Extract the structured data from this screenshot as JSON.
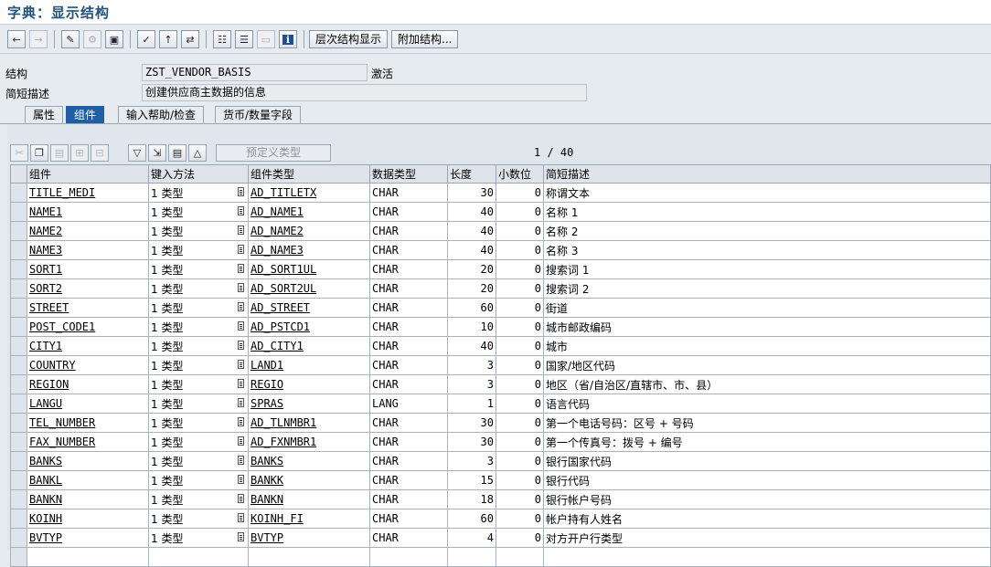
{
  "title": "字典：显示结构",
  "toolbar": {
    "icons": [
      "back-icon",
      "forward-icon",
      "display-change-icon",
      "active-inactive-icon",
      "other-object-icon",
      "check-icon",
      "activate-icon",
      "where-used-icon",
      "object-list-icon",
      "display-object-list-icon",
      "navigation-window-icon",
      "info-icon"
    ],
    "hier_label": "层次结构显示",
    "append_label": "附加结构..."
  },
  "header": {
    "structure_label": "结构",
    "structure_value": "ZST_VENDOR_BASIS",
    "status": "激活",
    "desc_label": "简短描述",
    "desc_value": "创建供应商主数据的信息"
  },
  "tabs": [
    {
      "label": "属性",
      "active": false
    },
    {
      "label": "组件",
      "active": true
    },
    {
      "label": "输入帮助/检查",
      "active": false
    },
    {
      "label": "货币/数量字段",
      "active": false
    }
  ],
  "grid_toolbar": {
    "predefined_label": "预定义类型",
    "pager": "1 / 40"
  },
  "table": {
    "columns": [
      "组件",
      "键入方法",
      "组件类型",
      "数据类型",
      "长度",
      "小数位",
      "简短描述"
    ],
    "rows": [
      {
        "comp": "TITLE_MEDI",
        "method": "1 类型",
        "ctype": "AD_TITLETX",
        "dtype": "CHAR",
        "len": "30",
        "dec": "0",
        "desc": "称谓文本"
      },
      {
        "comp": "NAME1",
        "method": "1 类型",
        "ctype": "AD_NAME1",
        "dtype": "CHAR",
        "len": "40",
        "dec": "0",
        "desc": "名称 1"
      },
      {
        "comp": "NAME2",
        "method": "1 类型",
        "ctype": "AD_NAME2",
        "dtype": "CHAR",
        "len": "40",
        "dec": "0",
        "desc": "名称 2"
      },
      {
        "comp": "NAME3",
        "method": "1 类型",
        "ctype": "AD_NAME3",
        "dtype": "CHAR",
        "len": "40",
        "dec": "0",
        "desc": "名称 3"
      },
      {
        "comp": "SORT1",
        "method": "1 类型",
        "ctype": "AD_SORT1UL",
        "dtype": "CHAR",
        "len": "20",
        "dec": "0",
        "desc": "搜索词 1"
      },
      {
        "comp": "SORT2",
        "method": "1 类型",
        "ctype": "AD_SORT2UL",
        "dtype": "CHAR",
        "len": "20",
        "dec": "0",
        "desc": "搜索词 2"
      },
      {
        "comp": "STREET",
        "method": "1 类型",
        "ctype": "AD_STREET",
        "dtype": "CHAR",
        "len": "60",
        "dec": "0",
        "desc": "街道"
      },
      {
        "comp": "POST_CODE1",
        "method": "1 类型",
        "ctype": "AD_PSTCD1",
        "dtype": "CHAR",
        "len": "10",
        "dec": "0",
        "desc": "城市邮政编码"
      },
      {
        "comp": "CITY1",
        "method": "1 类型",
        "ctype": "AD_CITY1",
        "dtype": "CHAR",
        "len": "40",
        "dec": "0",
        "desc": "城市"
      },
      {
        "comp": "COUNTRY",
        "method": "1 类型",
        "ctype": "LAND1",
        "dtype": "CHAR",
        "len": "3",
        "dec": "0",
        "desc": "国家/地区代码"
      },
      {
        "comp": "REGION",
        "method": "1 类型",
        "ctype": "REGIO",
        "dtype": "CHAR",
        "len": "3",
        "dec": "0",
        "desc": "地区（省/自治区/直辖市、市、县）"
      },
      {
        "comp": "LANGU",
        "method": "1 类型",
        "ctype": "SPRAS",
        "dtype": "LANG",
        "len": "1",
        "dec": "0",
        "desc": "语言代码"
      },
      {
        "comp": "TEL_NUMBER",
        "method": "1 类型",
        "ctype": "AD_TLNMBR1",
        "dtype": "CHAR",
        "len": "30",
        "dec": "0",
        "desc": "第一个电话号码：区号 + 号码"
      },
      {
        "comp": "FAX_NUMBER",
        "method": "1 类型",
        "ctype": "AD_FXNMBR1",
        "dtype": "CHAR",
        "len": "30",
        "dec": "0",
        "desc": "第一个传真号：拨号 + 编号"
      },
      {
        "comp": "BANKS",
        "method": "1 类型",
        "ctype": "BANKS",
        "dtype": "CHAR",
        "len": "3",
        "dec": "0",
        "desc": "银行国家代码"
      },
      {
        "comp": "BANKL",
        "method": "1 类型",
        "ctype": "BANKK",
        "dtype": "CHAR",
        "len": "15",
        "dec": "0",
        "desc": "银行代码"
      },
      {
        "comp": "BANKN",
        "method": "1 类型",
        "ctype": "BANKN",
        "dtype": "CHAR",
        "len": "18",
        "dec": "0",
        "desc": "银行帐户号码"
      },
      {
        "comp": "KOINH",
        "method": "1 类型",
        "ctype": "KOINH_FI",
        "dtype": "CHAR",
        "len": "60",
        "dec": "0",
        "desc": "帐户持有人姓名"
      },
      {
        "comp": "BVTYP",
        "method": "1 类型",
        "ctype": "BVTYP",
        "dtype": "CHAR",
        "len": "4",
        "dec": "0",
        "desc": "对方开户行类型"
      },
      {
        "comp": "",
        "method": "",
        "ctype": "",
        "dtype": "",
        "len": "",
        "dec": "",
        "desc": ""
      }
    ]
  }
}
